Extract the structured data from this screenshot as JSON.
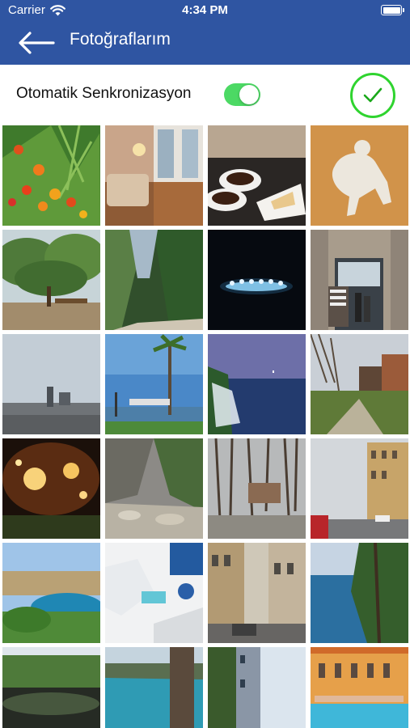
{
  "status_bar": {
    "carrier": "Carrier",
    "time": "4:34 PM",
    "wifi_icon": "wifi-icon",
    "battery_icon": "battery-icon"
  },
  "nav": {
    "back_icon": "arrow-left-icon",
    "title": "Fotoğraflarım"
  },
  "sync": {
    "label": "Otomatik Senkronizasyon",
    "enabled": true,
    "confirm_icon": "checkmark-icon"
  },
  "colors": {
    "header_bg": "#2f55a2",
    "toggle_on": "#4cd964",
    "confirm_ring": "#2fd42f"
  },
  "photos": [
    {
      "subject": "flowers"
    },
    {
      "subject": "living-room"
    },
    {
      "subject": "coffee-and-cake"
    },
    {
      "subject": "clay-figurine"
    },
    {
      "subject": "park-trees"
    },
    {
      "subject": "mountain-valley"
    },
    {
      "subject": "night-stage"
    },
    {
      "subject": "shop-entrance"
    },
    {
      "subject": "misty-city"
    },
    {
      "subject": "palm-harbor"
    },
    {
      "subject": "waterfall-dusk"
    },
    {
      "subject": "forest-path"
    },
    {
      "subject": "night-lights"
    },
    {
      "subject": "rocky-river"
    },
    {
      "subject": "winter-trees"
    },
    {
      "subject": "street-buildings"
    },
    {
      "subject": "coastal-bay"
    },
    {
      "subject": "white-village"
    },
    {
      "subject": "old-buildings"
    },
    {
      "subject": "lake-trees"
    },
    {
      "subject": "pond-reflection"
    },
    {
      "subject": "sea-cliff"
    },
    {
      "subject": "tilted-street"
    },
    {
      "subject": "pool-hotel"
    }
  ]
}
